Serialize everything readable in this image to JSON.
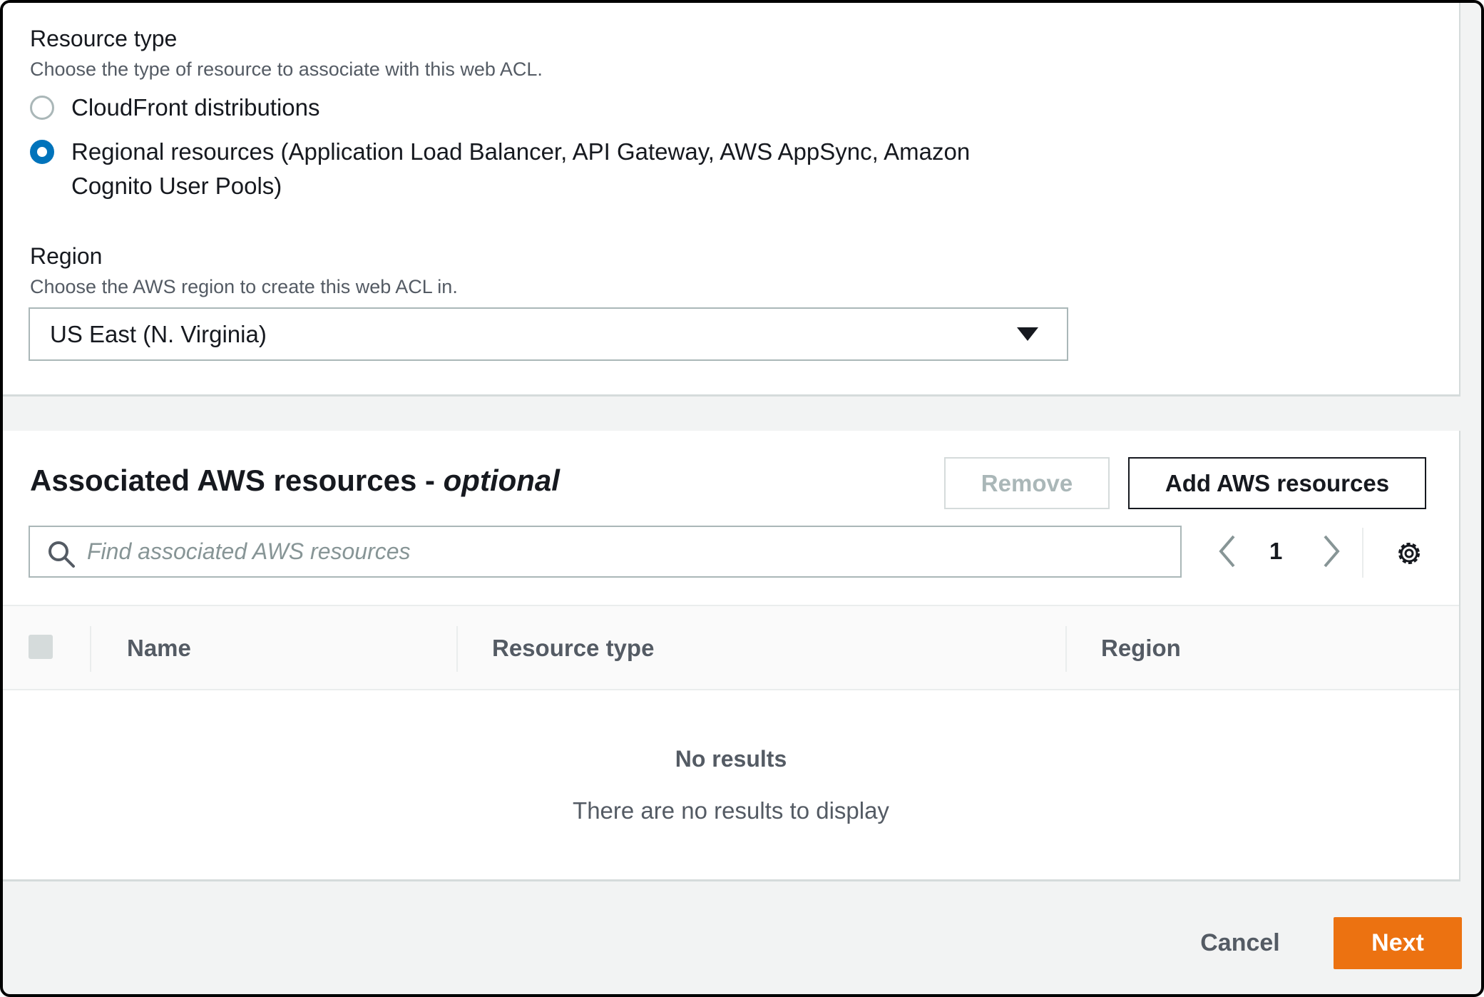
{
  "resource_type": {
    "label": "Resource type",
    "description": "Choose the type of resource to associate with this web ACL.",
    "options": [
      {
        "label": "CloudFront distributions",
        "selected": false
      },
      {
        "label_line1": "Regional resources (Application Load Balancer, API Gateway, AWS AppSync, Amazon",
        "label_line2": "Cognito User Pools)",
        "selected": true
      }
    ]
  },
  "region": {
    "label": "Region",
    "description": "Choose the AWS region to create this web ACL in.",
    "selected_value": "US East (N. Virginia)"
  },
  "associated": {
    "title": "Associated AWS resources - ",
    "title_suffix": "optional",
    "remove_label": "Remove",
    "add_label": "Add AWS resources",
    "search_placeholder": "Find associated AWS resources",
    "page_number": "1",
    "columns": [
      "Name",
      "Resource type",
      "Region"
    ],
    "empty_title": "No results",
    "empty_description": "There are no results to display"
  },
  "footer": {
    "cancel_label": "Cancel",
    "next_label": "Next"
  },
  "colors": {
    "primary": "#ec7211",
    "selected_radio": "#0073bb"
  },
  "icons": [
    "search-icon",
    "chevron-left-icon",
    "chevron-right-icon",
    "gear-icon",
    "caret-down-icon"
  ]
}
